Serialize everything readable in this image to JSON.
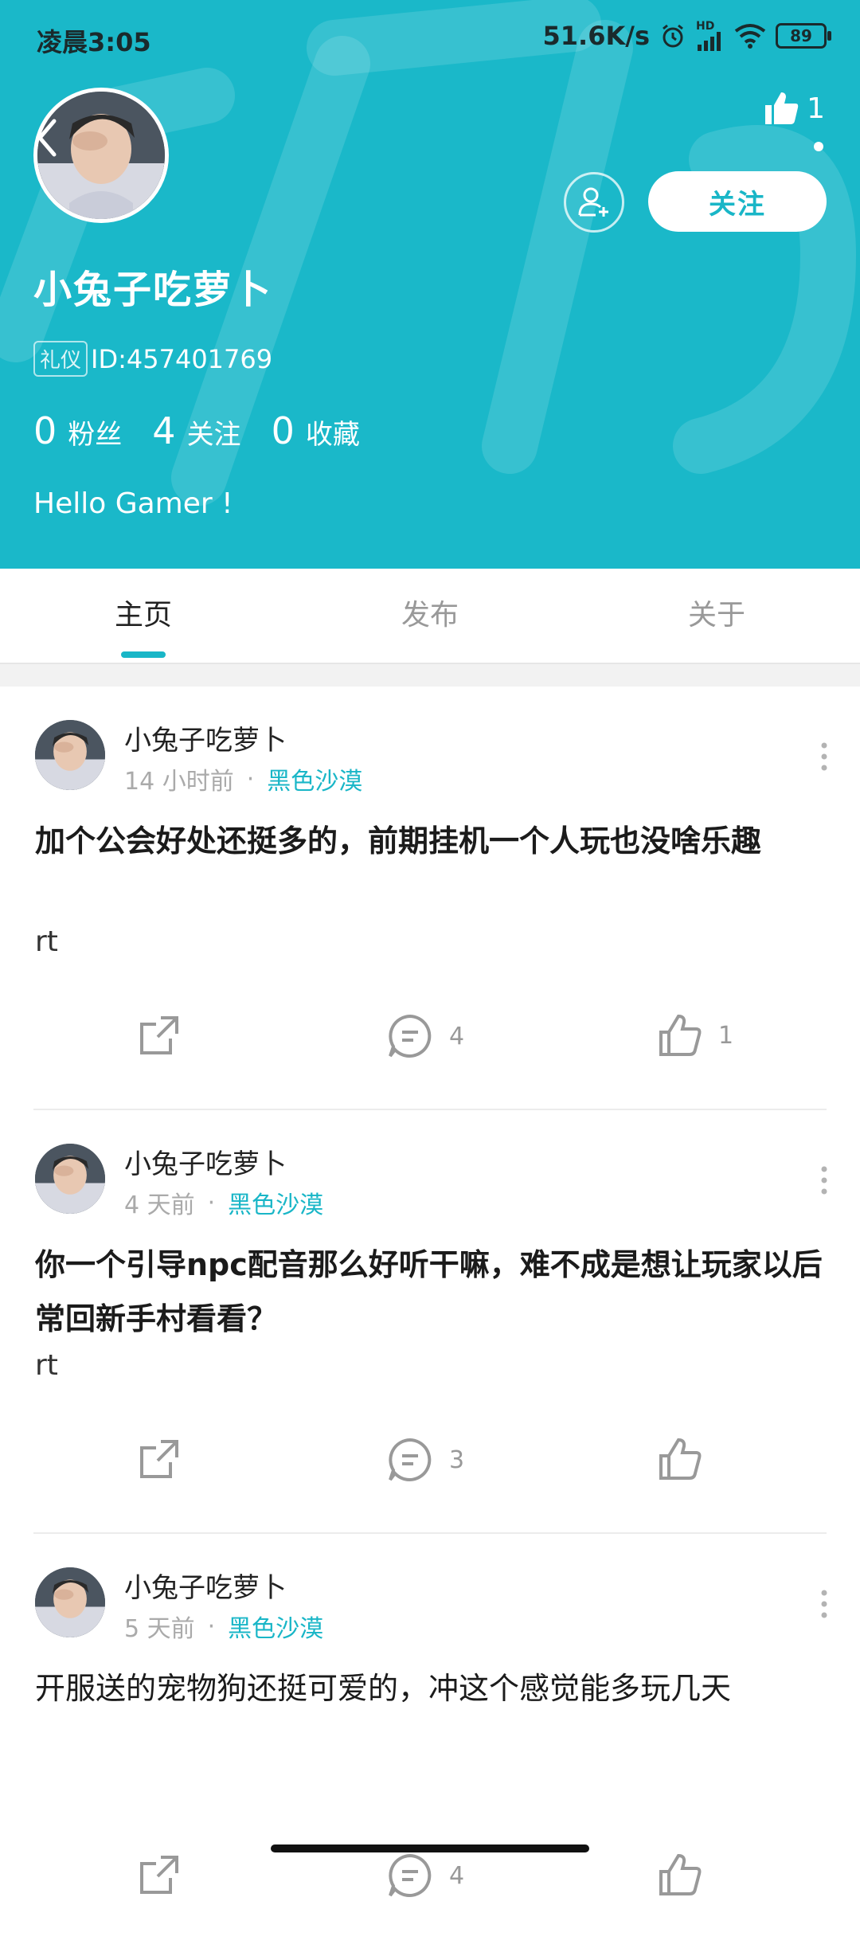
{
  "status_bar": {
    "time": "凌晨3:05",
    "network_speed": "51.6K/s",
    "signal_label": "HD",
    "battery": "89",
    "icons": [
      "alarm-icon",
      "signal-icon",
      "wifi-icon",
      "battery-icon"
    ]
  },
  "colors": {
    "accent": "#1ab8c9",
    "tag": "#19b6c7"
  },
  "profile": {
    "name": "小兔子吃萝卜",
    "badge": "礼仪",
    "id": "ID:457401769",
    "likes_count": "1",
    "follow_label": "关注",
    "stats": [
      {
        "num": "0",
        "label": "粉丝"
      },
      {
        "num": "4",
        "label": "关注"
      },
      {
        "num": "0",
        "label": "收藏"
      }
    ],
    "bio": "Hello Gamer !"
  },
  "tabs": [
    {
      "label": "主页",
      "active": true
    },
    {
      "label": "发布",
      "active": false
    },
    {
      "label": "关于",
      "active": false
    }
  ],
  "posts": [
    {
      "user": "小兔子吃萝卜",
      "time": "14 小时前",
      "separator": "·",
      "tag": "黑色沙漠",
      "title": "加个公会好处还挺多的，前期挂机一个人玩也没啥乐趣",
      "body": "rt",
      "comments": "4",
      "likes": "1"
    },
    {
      "user": "小兔子吃萝卜",
      "time": "4 天前",
      "separator": "·",
      "tag": "黑色沙漠",
      "title": "你一个引导npc配音那么好听干嘛，难不成是想让玩家以后常回新手村看看？",
      "body": "rt",
      "comments": "3",
      "likes": ""
    },
    {
      "user": "小兔子吃萝卜",
      "time": "5 天前",
      "separator": "·",
      "tag": "黑色沙漠",
      "title": "开服送的宠物狗还挺可爱的，冲这个感觉能多玩几天",
      "body": "",
      "comments": "4",
      "likes": ""
    }
  ]
}
